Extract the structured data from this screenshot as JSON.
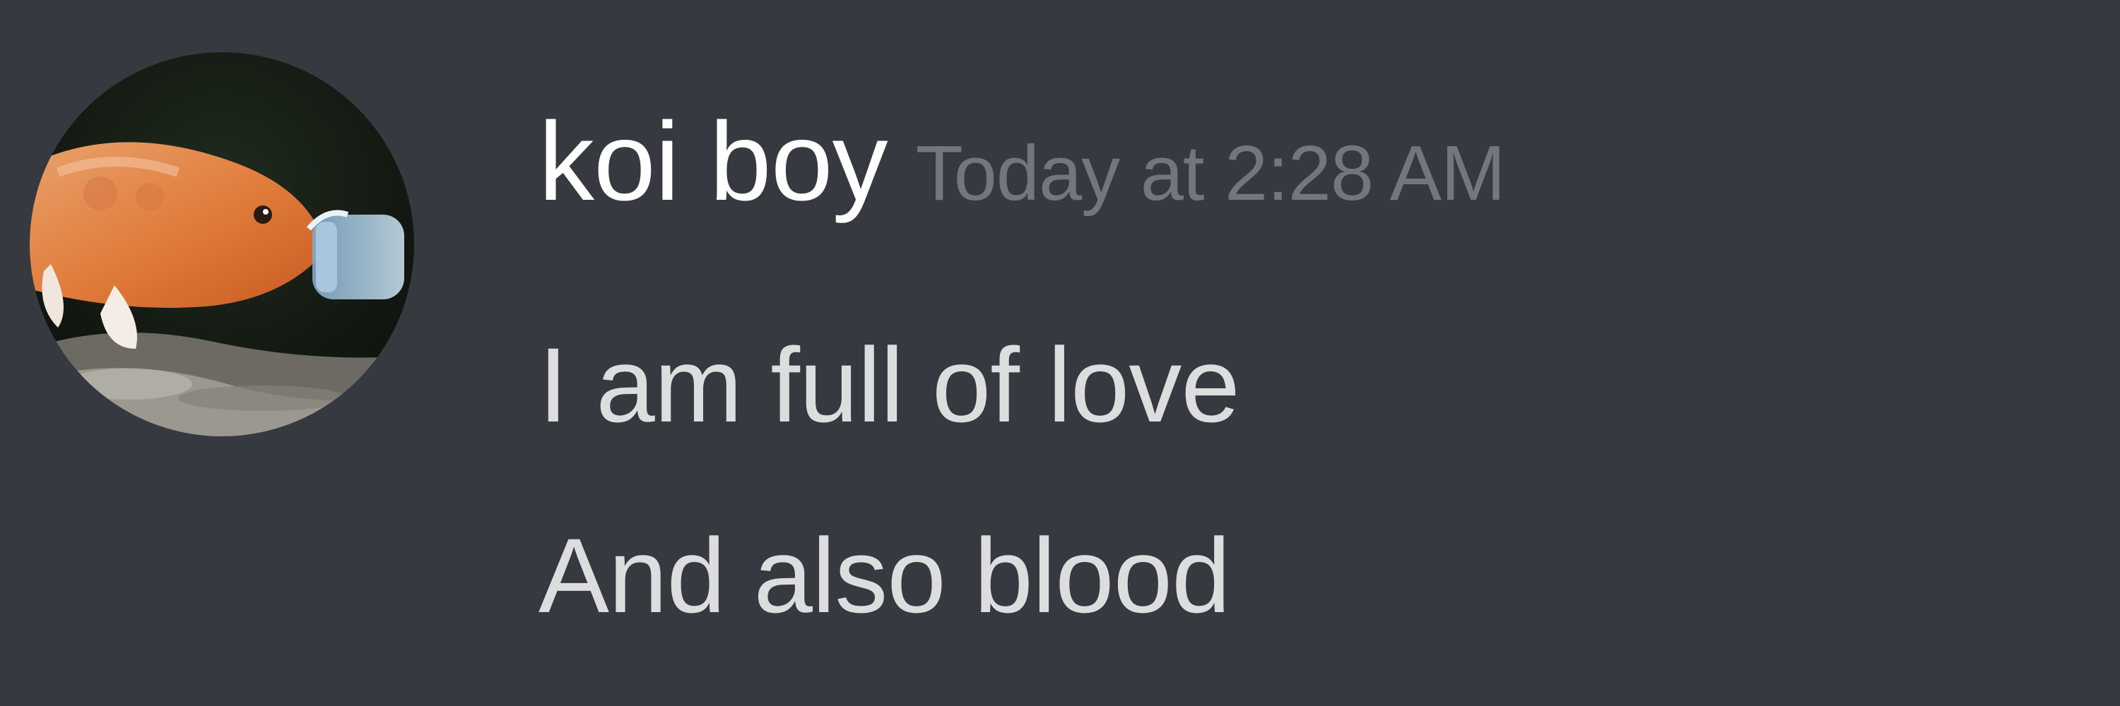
{
  "message": {
    "author": "koi boy",
    "timestamp": "Today at 2:28 AM",
    "avatar": "koi-fish-avatar",
    "lines": [
      "I am full of love",
      "And also blood"
    ]
  },
  "colors": {
    "background": "#36393f",
    "username": "#ffffff",
    "timestamp": "#72767d",
    "text": "#dcddde"
  }
}
